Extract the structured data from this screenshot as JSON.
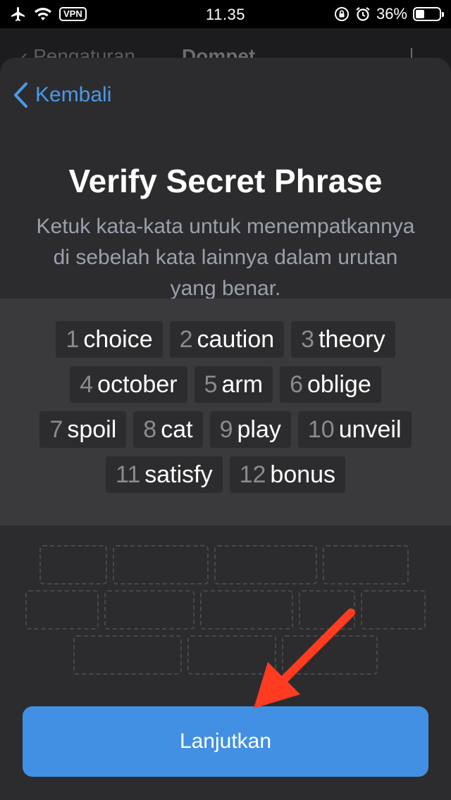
{
  "status_bar": {
    "time": "11.35",
    "vpn": "VPN",
    "battery_percent": "36%",
    "battery_level": 0.36
  },
  "background_nav": {
    "back_label": "Pengaturan",
    "title": "Dompet"
  },
  "sheet": {
    "back_label": "Kembali",
    "title": "Verify Secret Phrase",
    "subtitle": "Ketuk kata-kata untuk menempatkannya di sebelah kata lainnya dalam urutan yang benar.",
    "words": [
      {
        "num": "1",
        "word": "choice"
      },
      {
        "num": "2",
        "word": "caution"
      },
      {
        "num": "3",
        "word": "theory"
      },
      {
        "num": "4",
        "word": "october"
      },
      {
        "num": "5",
        "word": "arm"
      },
      {
        "num": "6",
        "word": "oblige"
      },
      {
        "num": "7",
        "word": "spoil"
      },
      {
        "num": "8",
        "word": "cat"
      },
      {
        "num": "9",
        "word": "play"
      },
      {
        "num": "10",
        "word": "unveil"
      },
      {
        "num": "11",
        "word": "satisfy"
      },
      {
        "num": "12",
        "word": "bonus"
      }
    ],
    "continue_label": "Lanjutkan"
  },
  "colors": {
    "accent": "#4290e3",
    "link": "#4c98e8",
    "annotation_arrow": "#ff3b22"
  }
}
